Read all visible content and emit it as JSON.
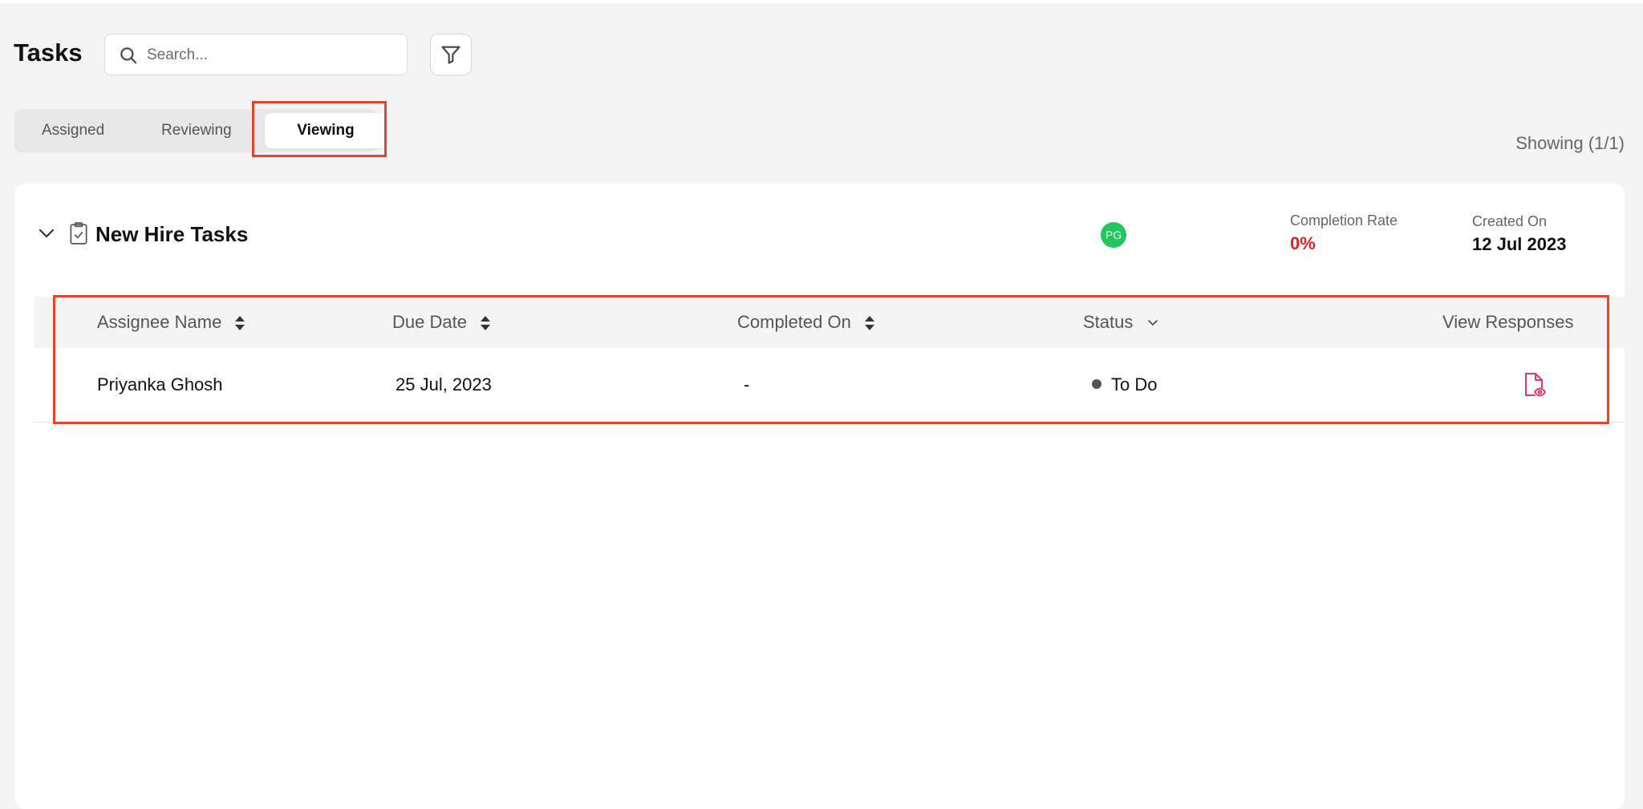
{
  "header": {
    "title": "Tasks",
    "search_placeholder": "Search..."
  },
  "tabs": [
    {
      "label": "Assigned",
      "active": false
    },
    {
      "label": "Reviewing",
      "active": false
    },
    {
      "label": "Viewing",
      "active": true
    }
  ],
  "showing_text": "Showing (1/1)",
  "group": {
    "title": "New Hire Tasks",
    "avatar_initials": "PG",
    "completion_rate_label": "Completion Rate",
    "completion_rate_value": "0%",
    "created_on_label": "Created On",
    "created_on_value": "12 Jul 2023"
  },
  "table": {
    "columns": [
      "Assignee Name",
      "Due Date",
      "Completed On",
      "Status",
      "View Responses"
    ],
    "rows": [
      {
        "assignee": "Priyanka Ghosh",
        "due_date": "25 Jul, 2023",
        "completed_on": "-",
        "status": "To Do"
      }
    ]
  },
  "colors": {
    "accent_red": "#e01f1f",
    "highlight_border": "#e8412c",
    "avatar_green": "#22c55e",
    "response_icon": "#e8336b"
  },
  "icons": [
    "search-icon",
    "filter-icon",
    "chevron-down-icon",
    "clipboard-check-icon",
    "sort-icon",
    "document-view-icon"
  ]
}
